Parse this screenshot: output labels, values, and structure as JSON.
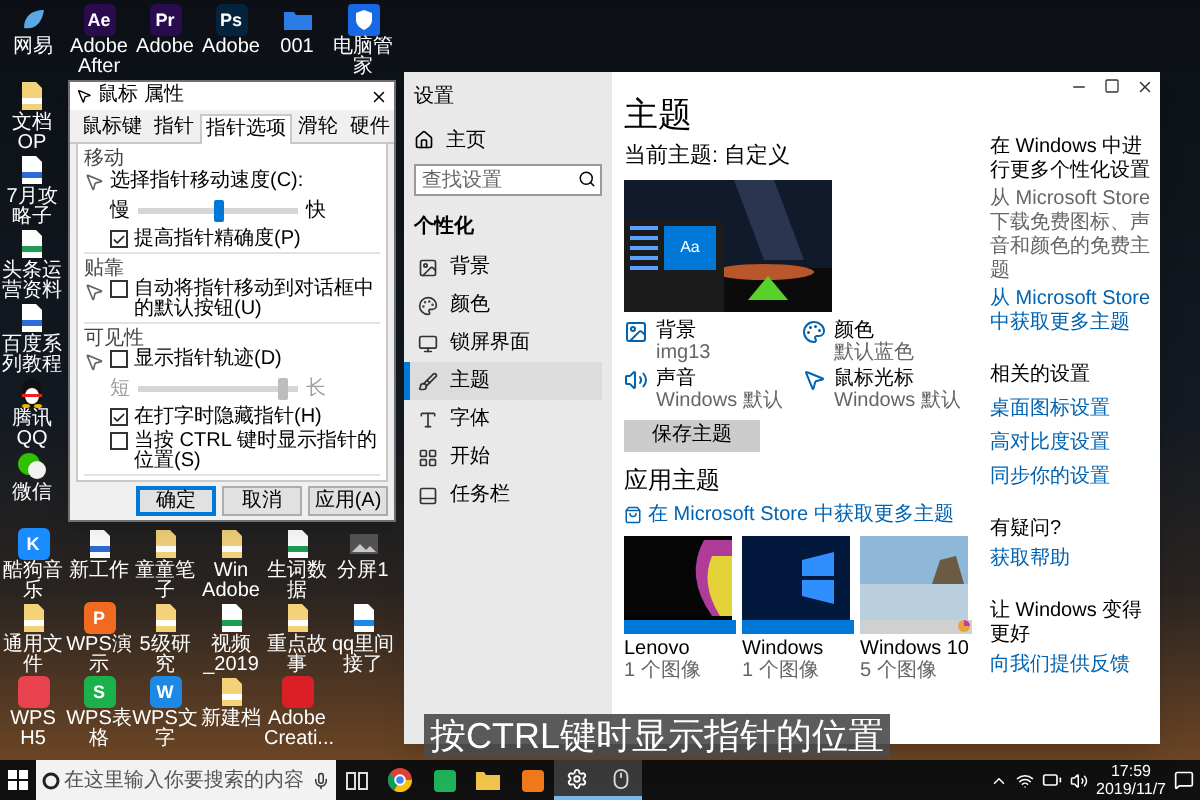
{
  "desktop_icons_top": [
    {
      "label": "网易",
      "kind": "app-blue"
    },
    {
      "label": "Adobe After",
      "kind": "tile",
      "glyph": "Ae",
      "color": "#2a0b4d"
    },
    {
      "label": "Adobe",
      "kind": "tile",
      "glyph": "Pr",
      "color": "#2a0b4d"
    },
    {
      "label": "Adobe",
      "kind": "tile",
      "glyph": "Ps",
      "color": "#06233d"
    },
    {
      "label": "001",
      "kind": "folder-blue"
    },
    {
      "label": "电脑管家",
      "kind": "shield"
    }
  ],
  "desktop_icons_left": [
    {
      "label": "文档OP",
      "kind": "folder-doc"
    },
    {
      "label": "7月攻略子",
      "kind": "doc"
    },
    {
      "label": "头条运营资料",
      "kind": "sheet"
    },
    {
      "label": "百度系列教程",
      "kind": "doc"
    },
    {
      "label": "腾讯QQ",
      "kind": "penguin"
    },
    {
      "label": "微信",
      "kind": "chat"
    }
  ],
  "desktop_icons_bottom": [
    {
      "label": "酷狗音乐",
      "kind": "tile",
      "glyph": "K",
      "color": "#1a8cff"
    },
    {
      "label": "新工作",
      "kind": "doc"
    },
    {
      "label": "童童笔子",
      "kind": "folder-doc"
    },
    {
      "label": "Win Adobe",
      "kind": "folder-doc"
    },
    {
      "label": "生词数据",
      "kind": "sheet"
    },
    {
      "label": "分屏1",
      "kind": "image"
    },
    {
      "label": "通用文件",
      "kind": "folder-doc"
    },
    {
      "label": "WPS演示",
      "kind": "tile",
      "glyph": "P",
      "color": "#f06a1f"
    },
    {
      "label": "5级研究",
      "kind": "folder-doc"
    },
    {
      "label": "视频_2019",
      "kind": "sheet"
    },
    {
      "label": "重点故事",
      "kind": "folder-doc"
    },
    {
      "label": "qq里间接了",
      "kind": "film"
    },
    {
      "label": "WPS H5",
      "kind": "tile",
      "color": "#e8424f"
    },
    {
      "label": "WPS表格",
      "kind": "tile",
      "glyph": "S",
      "color": "#1bb24b"
    },
    {
      "label": "WPS文字",
      "kind": "tile",
      "glyph": "W",
      "color": "#1e88e5"
    },
    {
      "label": "新建档",
      "kind": "folder-doc"
    },
    {
      "label": "Adobe Creati...",
      "kind": "tile",
      "color": "#da1f26"
    }
  ],
  "mouse_dialog": {
    "title": "鼠标 属性",
    "tabs": [
      {
        "label": "鼠标键",
        "selected": false
      },
      {
        "label": "指针",
        "selected": false
      },
      {
        "label": "指针选项",
        "selected": true
      },
      {
        "label": "滑轮",
        "selected": false
      },
      {
        "label": "硬件",
        "selected": false
      }
    ],
    "groups": [
      {
        "title": "移动",
        "rows": [
          {
            "kind": "label",
            "text": "选择指针移动速度(C):"
          },
          {
            "kind": "slider",
            "min_label": "慢",
            "max_label": "快",
            "level": 0.5,
            "disabled": false
          },
          {
            "kind": "checkbox",
            "text": "提高指针精确度(P)",
            "checked": true
          }
        ]
      },
      {
        "title": "贴靠",
        "rows": [
          {
            "kind": "checkbox",
            "text": "自动将指针移动到对话框中的默认按钮(U)",
            "checked": false
          }
        ]
      },
      {
        "title": "可见性",
        "rows": [
          {
            "kind": "checkbox",
            "text": "显示指针轨迹(D)",
            "checked": false
          },
          {
            "kind": "slider",
            "min_label": "短",
            "max_label": "长",
            "level": 0.9,
            "disabled": true
          },
          {
            "kind": "checkbox",
            "text": "在打字时隐藏指针(H)",
            "checked": true
          },
          {
            "kind": "checkbox",
            "text": "当按 CTRL 键时显示指针的位置(S)",
            "checked": false
          }
        ]
      }
    ],
    "buttons": [
      {
        "label": "确定",
        "default": true
      },
      {
        "label": "取消",
        "default": false
      },
      {
        "label": "应用(A)",
        "default": false
      }
    ]
  },
  "settings": {
    "title": "设置",
    "home": "主页",
    "search_placeholder": "查找设置",
    "section": "个性化",
    "nav": [
      {
        "label": "背景",
        "kind": "image",
        "selected": false
      },
      {
        "label": "颜色",
        "kind": "palette",
        "selected": false
      },
      {
        "label": "锁屏界面",
        "kind": "monitor",
        "selected": false
      },
      {
        "label": "主题",
        "kind": "brush",
        "selected": true
      },
      {
        "label": "字体",
        "kind": "font",
        "selected": false
      },
      {
        "label": "开始",
        "kind": "grid",
        "selected": false
      },
      {
        "label": "任务栏",
        "kind": "taskbar",
        "selected": false
      }
    ],
    "heading": "主题",
    "current_theme": "当前主题: 自定义",
    "preview_sample": "Aa",
    "attributes": [
      {
        "kind": "image",
        "name": "背景",
        "value": "img13"
      },
      {
        "kind": "palette",
        "name": "颜色",
        "value": "默认蓝色"
      },
      {
        "kind": "sound",
        "name": "声音",
        "value": "Windows 默认"
      },
      {
        "kind": "cursor",
        "name": "鼠标光标",
        "value": "Windows 默认"
      }
    ],
    "save_button": "保存主题",
    "apply_heading": "应用主题",
    "store_link": "在 Microsoft Store 中获取更多主题",
    "themes": [
      {
        "name": "Lenovo",
        "count": "1 个图像",
        "kind": "lenovo",
        "color": "#0078d7"
      },
      {
        "name": "Windows",
        "count": "1 个图像",
        "kind": "windows",
        "color": "#0078d7"
      },
      {
        "name": "Windows 10",
        "count": "5 个图像",
        "kind": "beach",
        "color": "#d0d0d0"
      }
    ],
    "side": {
      "more_heading": "在 Windows 中进行更多个性化设置",
      "more_text": "从 Microsoft Store 下载免费图标、声音和颜色的免费主题",
      "more_link": "从 Microsoft Store 中获取更多主题",
      "related_heading": "相关的设置",
      "related_links": [
        "桌面图标设置",
        "高对比度设置",
        "同步你的设置"
      ],
      "help_heading": "有疑问?",
      "help_link": "获取帮助",
      "feedback_heading": "让 Windows 变得更好",
      "feedback_link": "向我们提供反馈"
    }
  },
  "caption": "按CTRL键时显示指针的位置",
  "taskbar": {
    "search_placeholder": "在这里输入你要搜索的内容",
    "apps": [
      {
        "kind": "browser",
        "active": false
      },
      {
        "kind": "green-app",
        "active": false
      },
      {
        "kind": "folder",
        "active": false
      },
      {
        "kind": "orange-app",
        "active": false
      },
      {
        "kind": "gear",
        "active": true
      },
      {
        "kind": "mouse",
        "active": true
      }
    ],
    "time": "17:59",
    "date": "2019/11/7"
  }
}
